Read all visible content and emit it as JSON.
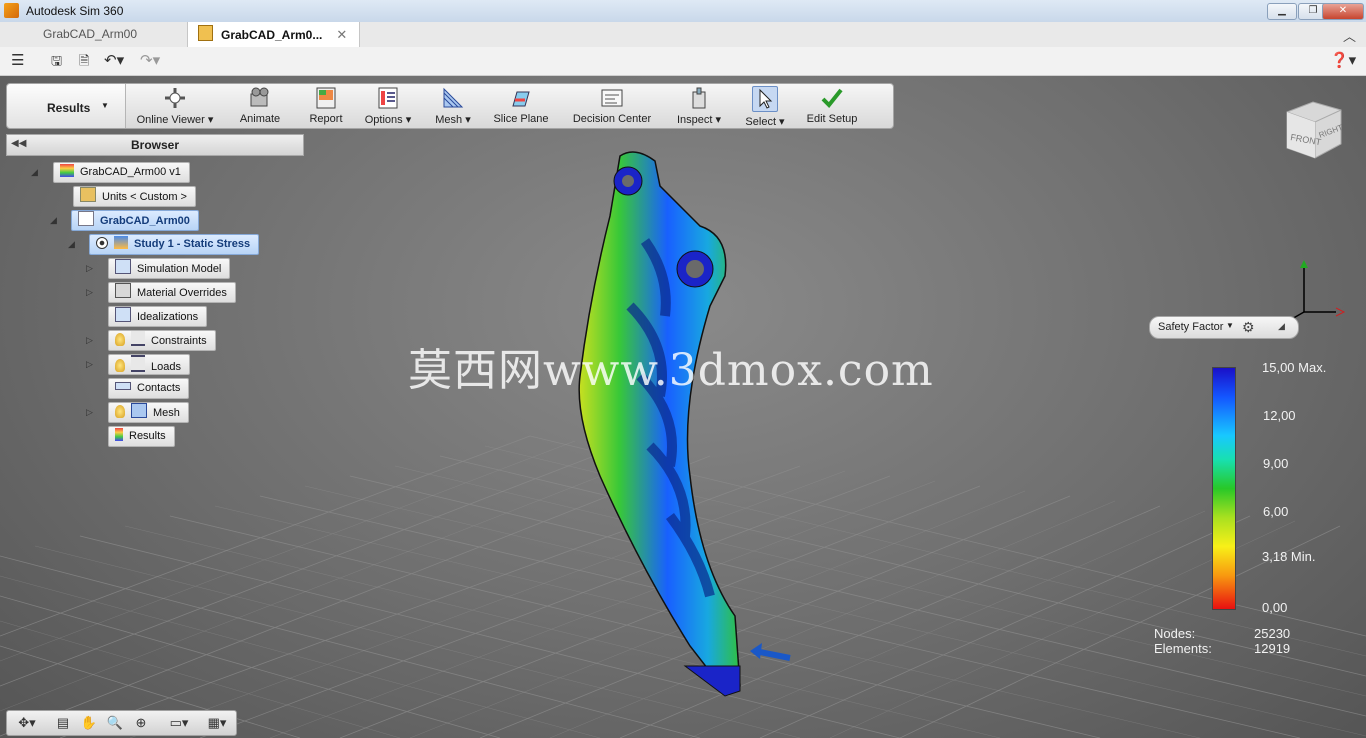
{
  "window": {
    "title": "Autodesk Sim 360",
    "minimize": "▁",
    "restore": "❐",
    "close": "✕"
  },
  "tabs": [
    {
      "label": "GrabCAD_Arm00"
    },
    {
      "label": "GrabCAD_Arm0...",
      "close": "✕"
    }
  ],
  "toolbar": {
    "mode": "Results",
    "tools": [
      {
        "label": "Online Viewer ▾",
        "icon": "online-viewer-icon"
      },
      {
        "label": "Animate",
        "icon": "animate-icon"
      },
      {
        "label": "Report",
        "icon": "report-icon"
      },
      {
        "label": "Options ▾",
        "icon": "options-icon"
      },
      {
        "label": "Mesh ▾",
        "icon": "mesh-icon"
      },
      {
        "label": "Slice Plane",
        "icon": "slice-plane-icon"
      },
      {
        "label": "Decision Center",
        "icon": "decision-center-icon"
      },
      {
        "label": "Inspect ▾",
        "icon": "inspect-icon"
      },
      {
        "label": "Select ▾",
        "icon": "select-cursor-icon",
        "selected": true
      },
      {
        "label": "Edit Setup",
        "icon": "checkmark-icon"
      }
    ]
  },
  "browser": {
    "title": "Browser",
    "tree": {
      "root": "GrabCAD_Arm00 v1",
      "units": "Units < Custom >",
      "component": "GrabCAD_Arm00",
      "study": "Study 1 - Static Stress",
      "items": [
        "Simulation Model",
        "Material Overrides",
        "Idealizations",
        "Constraints",
        "Loads",
        "Contacts",
        "Mesh",
        "Results"
      ]
    }
  },
  "viewcube": {
    "front": "FRONT",
    "right": "RIGHT"
  },
  "result_type": "Safety Factor",
  "legend": {
    "labels": [
      "15,00 Max.",
      "12,00",
      "9,00",
      "6,00",
      "3,18 Min.",
      "0,00"
    ],
    "colors": [
      "#1a10c8",
      "#18c8ff",
      "#28c828",
      "#f8f018",
      "#e81010"
    ]
  },
  "stats": {
    "nodes_label": "Nodes:",
    "nodes_value": "25230",
    "elements_label": "Elements:",
    "elements_value": "12919"
  },
  "watermark": "莫西网www.3dmox.com"
}
